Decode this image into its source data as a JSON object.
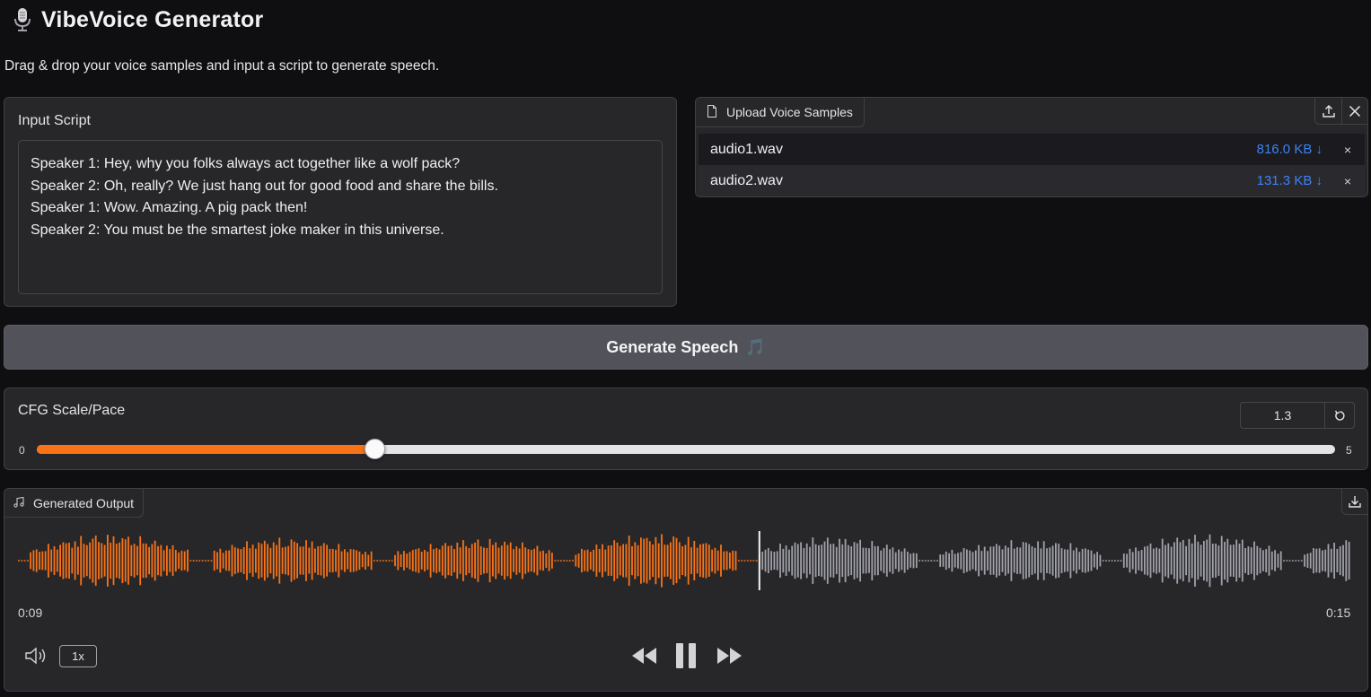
{
  "header": {
    "icon": "microphone-icon",
    "title": "VibeVoice Generator",
    "subtitle": "Drag & drop your voice samples and input a script to generate speech."
  },
  "script_panel": {
    "label": "Input Script",
    "value": "Speaker 1: Hey, why you folks always act together like a wolf pack?\nSpeaker 2: Oh, really? We just hang out for good food and share the bills.\nSpeaker 1: Wow. Amazing. A pig pack then!\nSpeaker 2: You must be the smartest joke maker in this universe."
  },
  "upload_panel": {
    "tab_label": "Upload Voice Samples",
    "files": [
      {
        "name": "audio1.wav",
        "size": "816.0 KB ↓",
        "remove": "×"
      },
      {
        "name": "audio2.wav",
        "size": "131.3 KB ↓",
        "remove": "×"
      }
    ]
  },
  "generate": {
    "label": "Generate Speech",
    "emoji": "🎵"
  },
  "cfg": {
    "label": "CFG Scale/Pace",
    "value": "1.3",
    "min": "0",
    "max": "5",
    "numeric_value": 1.3,
    "numeric_min": 0,
    "numeric_max": 5
  },
  "output": {
    "tab_label": "Generated Output",
    "current_time": "0:09",
    "total_time": "0:15",
    "speed": "1x",
    "progress": 0.555
  },
  "colors": {
    "accent": "#f97316",
    "waveform_unplayed": "#a1a1aa",
    "link": "#3b82f6"
  }
}
